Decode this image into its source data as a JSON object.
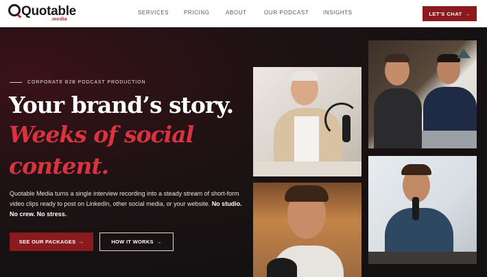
{
  "brand": {
    "name": "Quotable",
    "sub": ".media"
  },
  "nav": {
    "items": [
      {
        "label": "SERVICES"
      },
      {
        "label": "PRICING"
      },
      {
        "label": "ABOUT"
      },
      {
        "label": "OUR PODCAST"
      },
      {
        "label": "INSIGHTS"
      }
    ],
    "cta_label": "LET'S CHAT",
    "cta_icon": "arrow-right-icon"
  },
  "hero": {
    "eyebrow": "CORPORATE B2B PODCAST PRODUCTION",
    "headline": "Your brand’s story.",
    "headline_accent_line1": "Weeks of social",
    "headline_accent_line2": "content.",
    "description": "Quotable Media turns a single interview recording into a steady stream of short-form video clips ready to post on LinkedIn, other social media, or your website.",
    "description_bold": "No studio. No crew. No stress.",
    "primary_button": "SEE OUR PACKAGES",
    "secondary_button": "HOW IT WORKS",
    "colors": {
      "accent": "#8b1a1e",
      "headline_accent": "#d9333f",
      "background": "#141012"
    }
  }
}
